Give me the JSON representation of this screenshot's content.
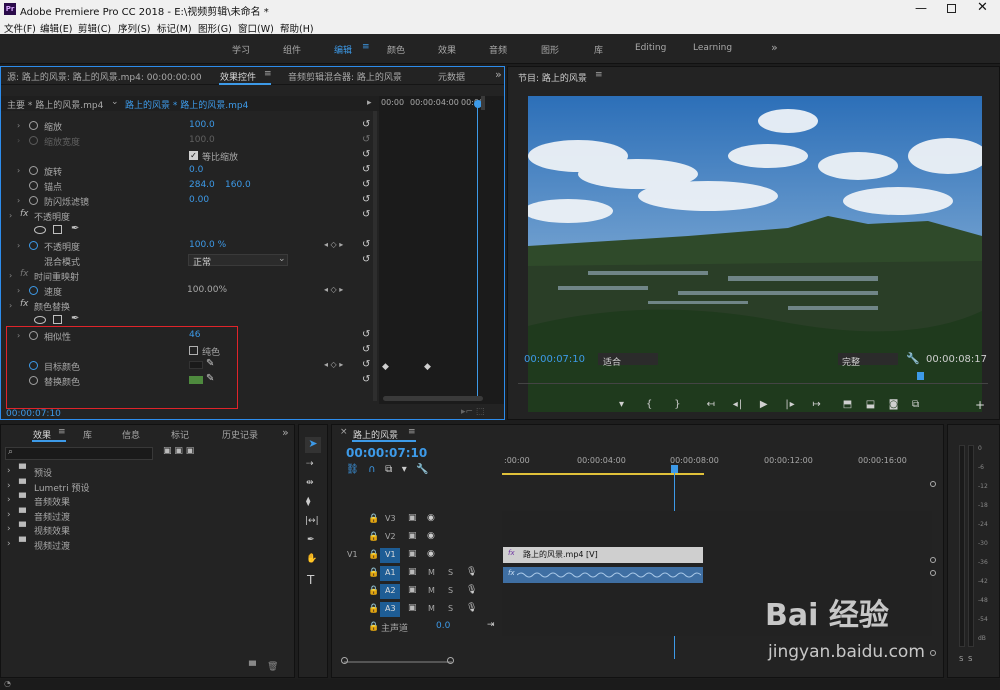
{
  "app": {
    "title": "Adobe Premiere Pro CC 2018 - E:\\视频剪辑\\未命名 *",
    "icon": "Pr"
  },
  "menu": [
    "文件(F)",
    "编辑(E)",
    "剪辑(C)",
    "序列(S)",
    "标记(M)",
    "图形(G)",
    "窗口(W)",
    "帮助(H)"
  ],
  "workspaces": [
    "学习",
    "组件",
    "编辑",
    "颜色",
    "效果",
    "音频",
    "图形",
    "库",
    "Editing",
    "Learning"
  ],
  "workspace_active": "编辑",
  "source_panel": {
    "tabs": [
      "源: 路上的风景: 路上的风景.mp4: 00:00:00:00",
      "效果控件",
      "音频剪辑混合器: 路上的风景",
      "元数据"
    ],
    "master": "主要 * 路上的风景.mp4",
    "seq": "路上的风景 * 路上的风景.mp4",
    "ruler": [
      "00:00",
      "00:00:04:00",
      "00:00"
    ],
    "rows": {
      "scale": {
        "label": "缩放",
        "value": "100.0"
      },
      "scale_width": {
        "label": "缩放宽度",
        "value": "100.0"
      },
      "uniform": {
        "label": "等比缩放"
      },
      "rotate": {
        "label": "旋转",
        "value": "0.0"
      },
      "anchor": {
        "label": "锚点",
        "x": "284.0",
        "y": "160.0"
      },
      "flicker": {
        "label": "防闪烁滤镜",
        "value": "0.00"
      },
      "opacity": {
        "label": "不透明度"
      },
      "opacity_val": {
        "label": "不透明度",
        "value": "100.0 %"
      },
      "blend": {
        "label": "混合模式",
        "value": "正常"
      },
      "remap": {
        "label": "时间重映射"
      },
      "speed": {
        "label": "速度",
        "value": "100.00%"
      },
      "colorrep": {
        "label": "颜色替换"
      },
      "similarity": {
        "label": "相似性",
        "value": "46"
      },
      "solid": {
        "label": "纯色"
      },
      "target": {
        "label": "目标颜色"
      },
      "replace": {
        "label": "替换颜色"
      }
    },
    "timecode": "00:00:07:10",
    "fx": "fx"
  },
  "program": {
    "title": "节目: 路上的风景",
    "timecode": "00:00:07:10",
    "fit": "适合",
    "quality": "完整",
    "duration": "00:00:08:17"
  },
  "project": {
    "tabs": [
      "效果",
      "库",
      "信息",
      "标记",
      "历史记录"
    ],
    "items": [
      "预设",
      "Lumetri 预设",
      "音频效果",
      "音频过渡",
      "视频效果",
      "视频过渡"
    ]
  },
  "timeline": {
    "tab": "路上的风景",
    "timecode": "00:00:07:10",
    "ruler": [
      ":00:00",
      "00:00:04:00",
      "00:00:08:00",
      "00:00:12:00",
      "00:00:16:00"
    ],
    "video_tracks": [
      "V3",
      "V2",
      "V1"
    ],
    "audio_tracks": [
      "A1",
      "A2",
      "A3"
    ],
    "source_v": "V1",
    "master": "主声道",
    "master_val": "0.0",
    "clip": "路上的风景.mp4 [V]"
  },
  "meter": {
    "labels": [
      "0",
      "-6",
      "-12",
      "-18",
      "-24",
      "-30",
      "-36",
      "-42",
      "-48",
      "-54",
      "dB"
    ],
    "solo": [
      "S",
      "S"
    ]
  },
  "watermark": {
    "brand": "Bai 经验",
    "url": "jingyan.baidu.com"
  }
}
